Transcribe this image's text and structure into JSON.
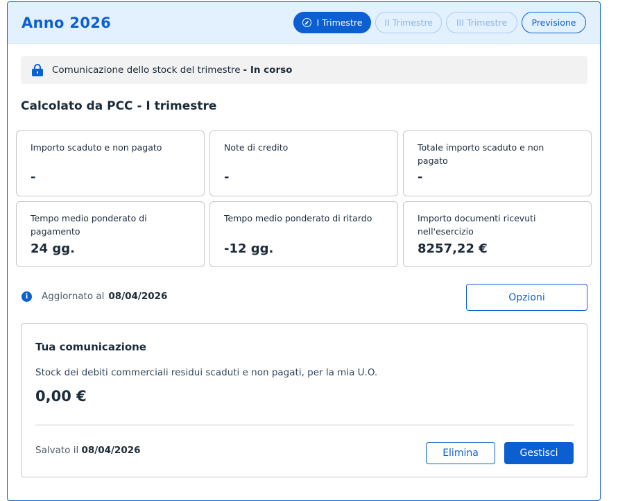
{
  "header": {
    "title": "Anno 2026",
    "tabs": [
      {
        "label": "I Trimestre",
        "state": "active"
      },
      {
        "label": "II Trimestre",
        "state": "disabled"
      },
      {
        "label": "III Trimestre",
        "state": "disabled"
      },
      {
        "label": "Previsione",
        "state": "normal"
      }
    ]
  },
  "notice": {
    "text": "Comunicazione dello stock del trimestre",
    "status": "- In corso"
  },
  "section": {
    "title": "Calcolato da PCC - I trimestre"
  },
  "cards": [
    {
      "label": "Importo scaduto e non pagato",
      "value": "-"
    },
    {
      "label": "Note di credito",
      "value": "-"
    },
    {
      "label": "Totale importo scaduto e non pagato",
      "value": "-"
    },
    {
      "label": "Tempo medio ponderato di pagamento",
      "value": "24 gg."
    },
    {
      "label": "Tempo medio ponderato di ritardo",
      "value": "-12 gg."
    },
    {
      "label": "Importo documenti ricevuti nell'esercizio",
      "value": "8257,22 €"
    }
  ],
  "updated": {
    "label": "Aggiornato al",
    "date": "08/04/2026"
  },
  "options_button": "Opzioni",
  "communication": {
    "title": "Tua comunicazione",
    "description": "Stock dei debiti commerciali residui scaduti e non pagati, per la mia U.O.",
    "amount": "0,00 €",
    "saved_label": "Salvato il",
    "saved_date": "08/04/2026",
    "delete_button": "Elimina",
    "manage_button": "Gestisci"
  },
  "colors": {
    "primary": "#0b5fd1",
    "header_bg": "#e3f0fd"
  }
}
